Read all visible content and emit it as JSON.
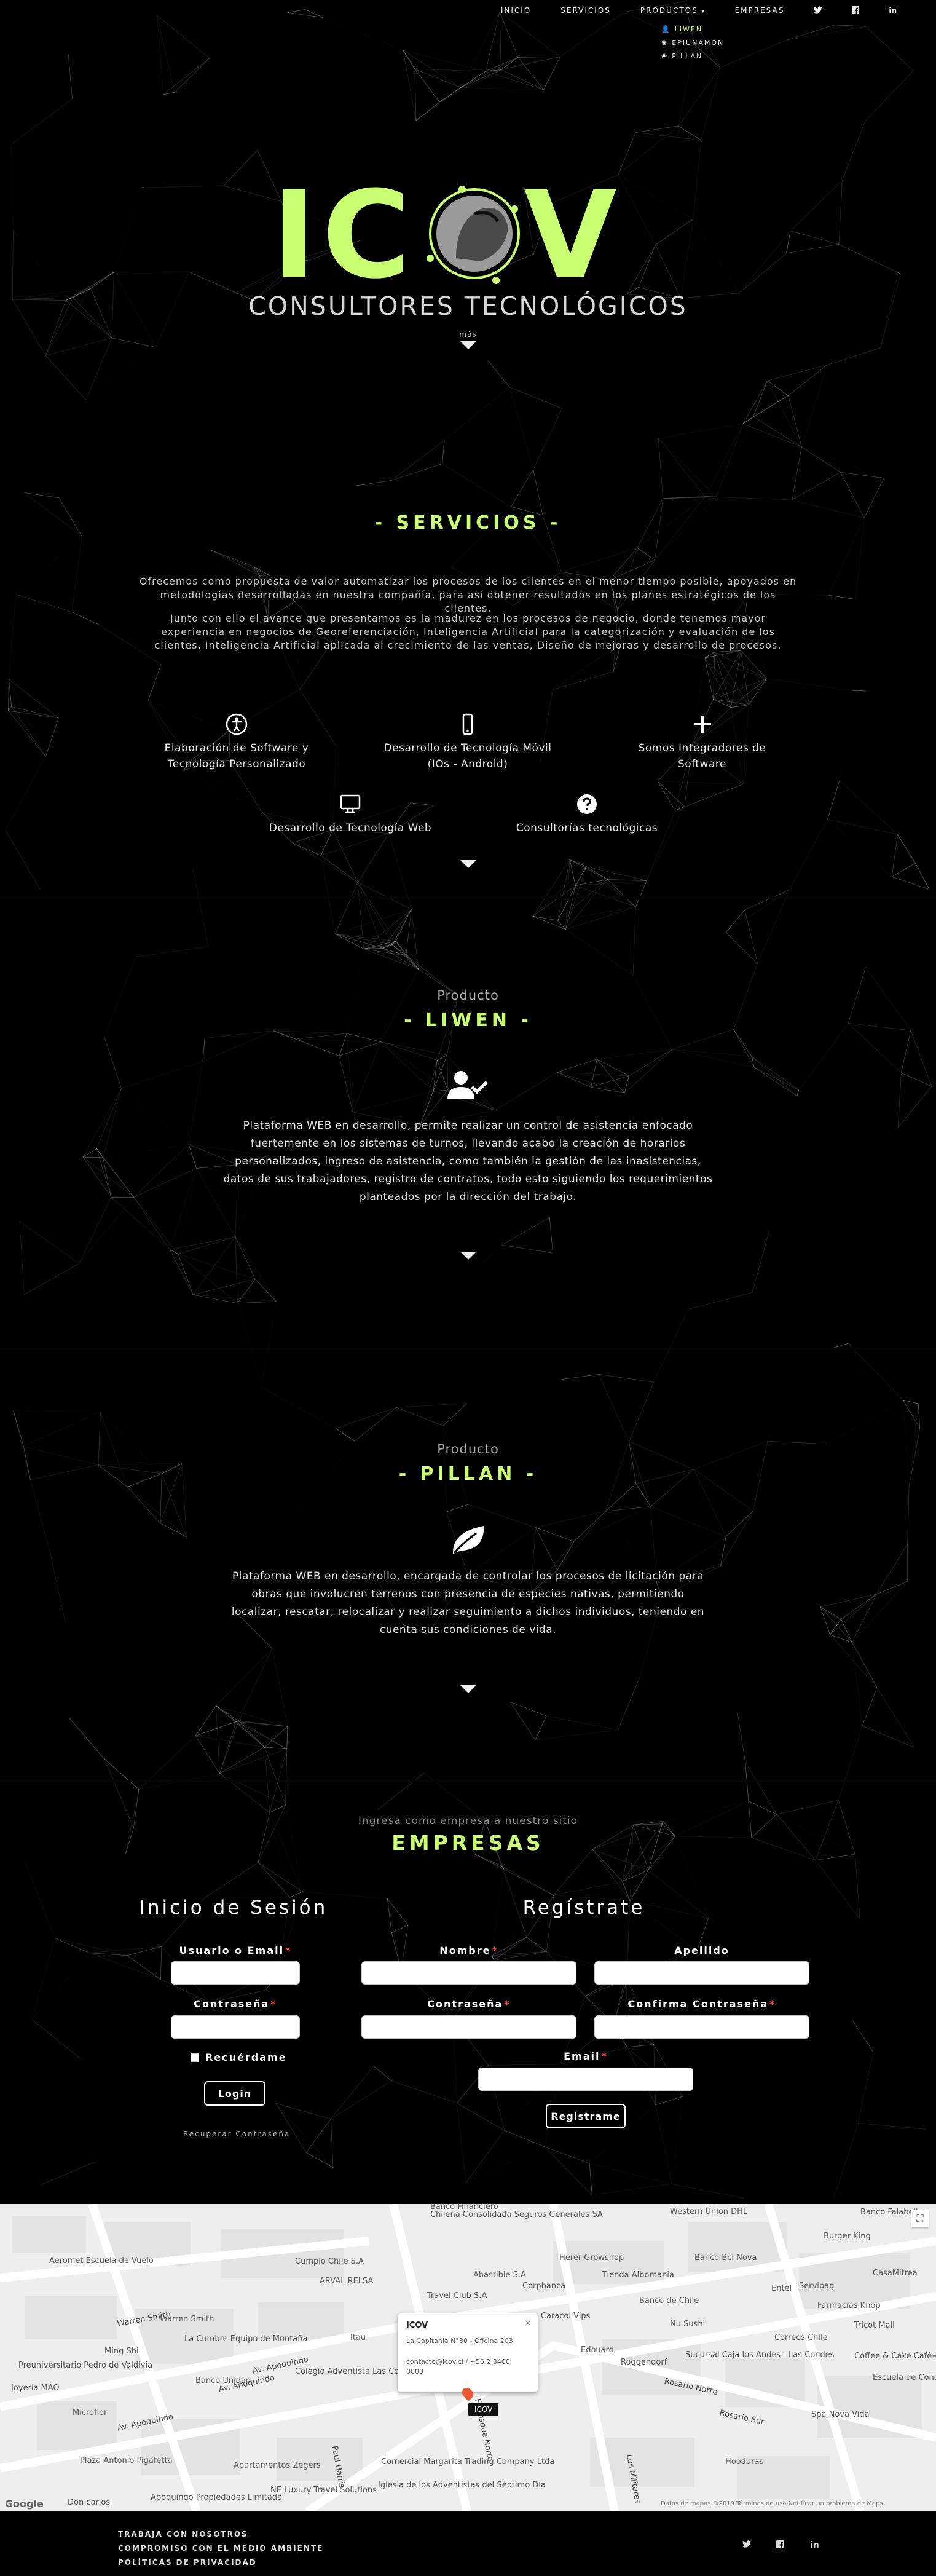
{
  "nav": {
    "items": [
      "INICIO",
      "SERVICIOS",
      "PRODUCTOS",
      "EMPRESAS"
    ],
    "social": [
      "twitter-icon",
      "facebook-icon",
      "linkedin-icon"
    ],
    "dropdown": [
      {
        "label": "LIWEN",
        "icon": "user-icon",
        "active": true
      },
      {
        "label": "EPIUNAMON",
        "icon": "leaf-icon",
        "active": false
      },
      {
        "label": "PILLAN",
        "icon": "leaf-icon",
        "active": false
      }
    ],
    "accent": "#c9ff72"
  },
  "hero": {
    "logo_word": "ICOV",
    "logo_sub": "CONSULTORES TECNOLÓGICOS",
    "more": "más"
  },
  "servicios": {
    "title": "- SERVICIOS -",
    "para1": "Ofrecemos como propuesta de valor automatizar los procesos de los clientes en el menor tiempo posible, apoyados en metodologías desarrolladas en nuestra compañía, para así obtener resultados en los planes estratégicos de los clientes.",
    "para2": "Junto con ello el avance que presentamos es la madurez en los procesos de negocio, donde tenemos mayor experiencia en negocios de Georeferenciación, Inteligencia Artificial para la categorización y evaluación de los clientes, Inteligencia Artificial aplicada al crecimiento de las ventas, Diseño de mejoras y desarrollo de procesos.",
    "items": [
      {
        "label": "Elaboración de Software y Tecnología Personalizado",
        "icon": "accessibility-icon"
      },
      {
        "label": "Desarrollo de Tecnología Móvil (IOs - Android)",
        "icon": "mobile-icon"
      },
      {
        "label": "Somos Integradores de Software",
        "icon": "plus-icon"
      },
      {
        "label": "Desarrollo de Tecnología Web",
        "icon": "desktop-icon"
      },
      {
        "label": "Consultorías tecnológicas",
        "icon": "question-icon"
      }
    ]
  },
  "liwen": {
    "pre": "Producto",
    "title": "- LIWEN -",
    "icon": "user-check-icon",
    "text": "Plataforma WEB en desarrollo, permite realizar un control de asistencia enfocado fuertemente en los sistemas de turnos, llevando acabo la creación de horarios personalizados, ingreso de asistencia, como también la gestión de las inasistencias, datos de sus trabajadores, registro de contratos, todo esto siguiendo los requerimientos planteados por la dirección del trabajo."
  },
  "pillan": {
    "pre": "Producto",
    "title": "- PILLAN -",
    "icon": "leaf-icon",
    "text": "Plataforma WEB en desarrollo, encargada de controlar los procesos de licitación para obras que involucren terrenos con presencia de especies nativas, permitiendo localizar, rescatar, relocalizar y realizar seguimiento a dichos individuos, teniendo en cuenta sus condiciones de vida."
  },
  "empresas": {
    "pre": "Ingresa como empresa a nuestro sitio",
    "title": "EMPRESAS",
    "login": {
      "title": "Inicio de Sesión",
      "user_label": "Usuario o Email",
      "pass_label": "Contraseña",
      "remember": "Recuérdame",
      "button": "Login",
      "recover": "Recuperar Contraseña"
    },
    "register": {
      "title": "Regístrate",
      "name_label": "Nombre",
      "last_label": "Apellido",
      "pass_label": "Contraseña",
      "confirm_label": "Confirma Contraseña",
      "email_label": "Email",
      "button": "Registrame"
    }
  },
  "map": {
    "info_title": "ICOV",
    "info_address": "La Capitanía N°80 - Oficina 203",
    "info_contact": "contacto@icov.cl / +56 2 3400 0000",
    "marker_label": "ICOV",
    "google": "Google",
    "terms": "Datos de mapas ©2019    Términos de uso    Notificar un problema de Maps",
    "places": [
      "Chilena Consolidada Seguros Generales SA",
      "Western Union DHL",
      "Burger King",
      "Banco Falabella",
      "Aeromet Escuela de Vuelo",
      "Cumplo Chile S.A",
      "Herer Growshop",
      "Banco Bci Nova",
      "CasaMitrea",
      "ARVAL RELSA",
      "Abastible S.A",
      "Tienda Albomania",
      "Travel Club S.A",
      "Corpbanca",
      "Entel",
      "Servipag",
      "Banco de Chile",
      "Farmacias Knop",
      "Warren Smith",
      "Caracol Vips",
      "Nu Sushi",
      "Tricot Mall",
      "La Cumbre Equipo de Montaña",
      "Itau",
      "Roggendorf",
      "Correos Chile",
      "Ming Shi",
      "Edouard",
      "Preuniversitario Pedro de Valdivia",
      "Banco Unidad",
      "Colegio Adventista Las Condes",
      "Sucursal Caja los Andes - Las Condes",
      "Coffee & Cake Café+",
      "Escuela de Conducir San Cristobal",
      "Joyería MAO",
      "Microflor",
      "Spa Nova Vida",
      "Plaza Antonio Pigafetta",
      "Apartamentos Zegers",
      "Comercial Margarita Trading Company Ltda",
      "Hooduras",
      "Don carlos",
      "NE Luxury Travel Solutions",
      "Iglesia de los Adventistas del Séptimo Día",
      "Apoquindo Propiedades Limitada",
      "Banco Financiero"
    ],
    "roads": [
      "Av. Apoquindo",
      "Av. Apoquindo",
      "Av. Apoquindo",
      "Rosario Norte",
      "Los Militares",
      "Paul Harris",
      "El Bosque Norte",
      "Warren Smith",
      "Rosario Sur"
    ]
  },
  "footer": {
    "links": [
      "TRABAJA CON NOSOTROS",
      "COMPROMISO CON EL MEDIO AMBIENTE",
      "POLÍTICAS DE PRIVACIDAD"
    ],
    "social": [
      "twitter-icon",
      "facebook-icon",
      "linkedin-icon"
    ]
  }
}
